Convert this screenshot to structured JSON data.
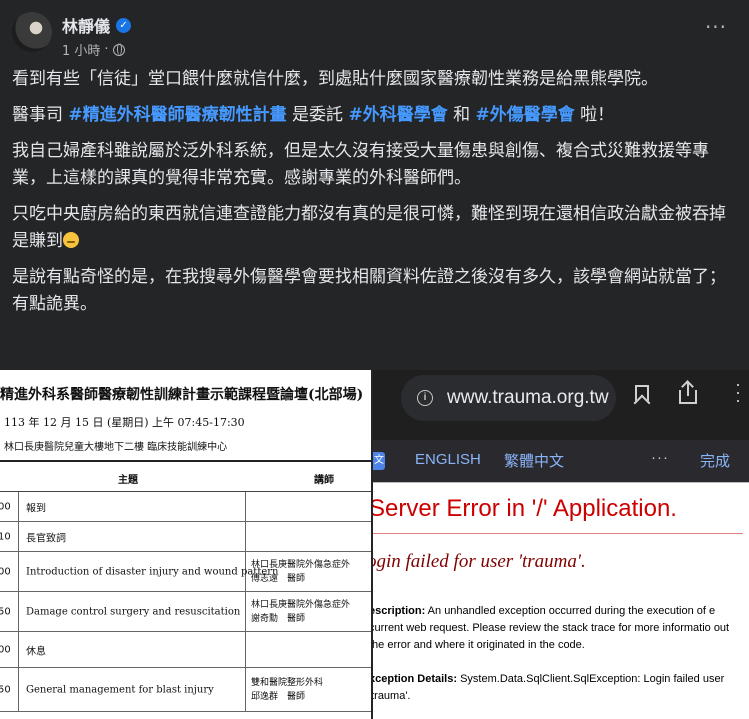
{
  "author": {
    "name": "林靜儀",
    "timestamp": "1 小時",
    "separator": "·"
  },
  "header": {
    "more_label": "···"
  },
  "post": {
    "p1": "看到有些「信徒」堂口餵什麼就信什麼，到處貼什麼國家醫療韌性業務是給黑熊學院。",
    "p2_a": "醫事司 ",
    "p2_tag1": "#精進外科醫師醫療韌性計畫",
    "p2_b": " 是委託 ",
    "p2_tag2": "#外科醫學會",
    "p2_c": " 和 ",
    "p2_tag3": "#外傷醫學會",
    "p2_d": " 啦！",
    "p3": "我自己婦產科雖說屬於泛外科系統，但是太久沒有接受大量傷患與創傷、複合式災難救援等專業，上這樣的課真的覺得非常充實。感謝專業的外科醫師們。",
    "p4": "只吃中央廚房給的東西就信連查證能力都沒有真的是很可憐，難怪到現在還相信政治獻金被吞掉是賺到",
    "p5": "是說有點奇怪的是，在我搜尋外傷醫學會要找相關資料佐證之後沒有多久，該學會網站就當了；有點詭異。"
  },
  "doc_image": {
    "title": "精進外科系醫師醫療韌性訓練計畫示範課程暨論壇(北部場)",
    "date": "113 年 12 月 15 日 (星期日) 上午 07:45-17:30",
    "venue": "林口長庚醫院兒童大樓地下二樓 臨床技能訓練中心",
    "header_topic": "主題",
    "header_speaker": "講師",
    "rows": [
      {
        "time": "00",
        "topic": "報到",
        "speaker": ""
      },
      {
        "time": "10",
        "topic": "長官致詞",
        "speaker": ""
      },
      {
        "time": "00",
        "topic": "Introduction of disaster injury and wound pattern",
        "speaker": "林口長庚醫院外傷急症外\n傅志遠　醫師"
      },
      {
        "time": "50",
        "topic": "Damage control surgery and resuscitation",
        "speaker": "林口長庚醫院外傷急症外\n謝奇勳　醫師"
      },
      {
        "time": "00",
        "topic": "休息",
        "speaker": ""
      },
      {
        "time": "50",
        "topic": "General management for blast injury",
        "speaker": "雙和醫院整形外科\n邱逸群　醫師"
      }
    ]
  },
  "browser": {
    "url": "www.trauma.org.tw",
    "translate": {
      "english_label": "ENGLISH",
      "chinese_label": "繁體中文",
      "more_label": "···",
      "done_label": "完成"
    },
    "error": {
      "title": "Server Error in '/' Application.",
      "subtitle": "ogin failed for user 'trauma'.",
      "desc_label": "escription:",
      "desc_text": " An unhandled exception occurred during the execution of e current web request. Please review the stack trace for more informatio out the error and where it originated in the code.",
      "details_label": "xception Details:",
      "details_text": " System.Data.SqlClient.SqlException: Login failed user 'trauma'."
    }
  }
}
